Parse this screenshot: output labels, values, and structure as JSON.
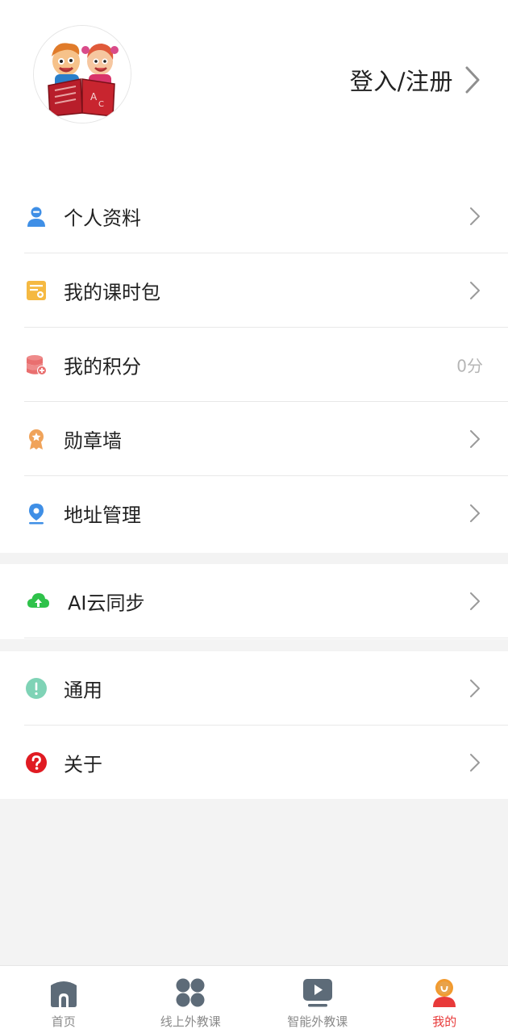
{
  "header": {
    "login_label": "登入/注册"
  },
  "menu": {
    "group1": [
      {
        "label": "个人资料",
        "icon": "user-icon",
        "value": ""
      },
      {
        "label": "我的课时包",
        "icon": "lesson-package-icon",
        "value": ""
      },
      {
        "label": "我的积分",
        "icon": "points-coins-icon",
        "value": "0分"
      },
      {
        "label": "勋章墙",
        "icon": "medal-icon",
        "value": ""
      },
      {
        "label": "地址管理",
        "icon": "location-pin-icon",
        "value": ""
      }
    ],
    "group2": [
      {
        "label": "AI云同步",
        "icon": "cloud-upload-icon",
        "value": ""
      }
    ],
    "group3": [
      {
        "label": "通用",
        "icon": "info-icon",
        "value": ""
      },
      {
        "label": "关于",
        "icon": "help-icon",
        "value": ""
      }
    ]
  },
  "tabbar": {
    "tabs": [
      {
        "label": "首页",
        "icon": "home-icon"
      },
      {
        "label": "线上外教课",
        "icon": "grid-icon"
      },
      {
        "label": "智能外教课",
        "icon": "play-video-icon"
      },
      {
        "label": "我的",
        "icon": "profile-icon"
      }
    ],
    "active_index": 3
  },
  "colors": {
    "active_tab": "#e83a3a",
    "inactive_tab": "#8a8a8a",
    "background": "#f3f3f3"
  }
}
